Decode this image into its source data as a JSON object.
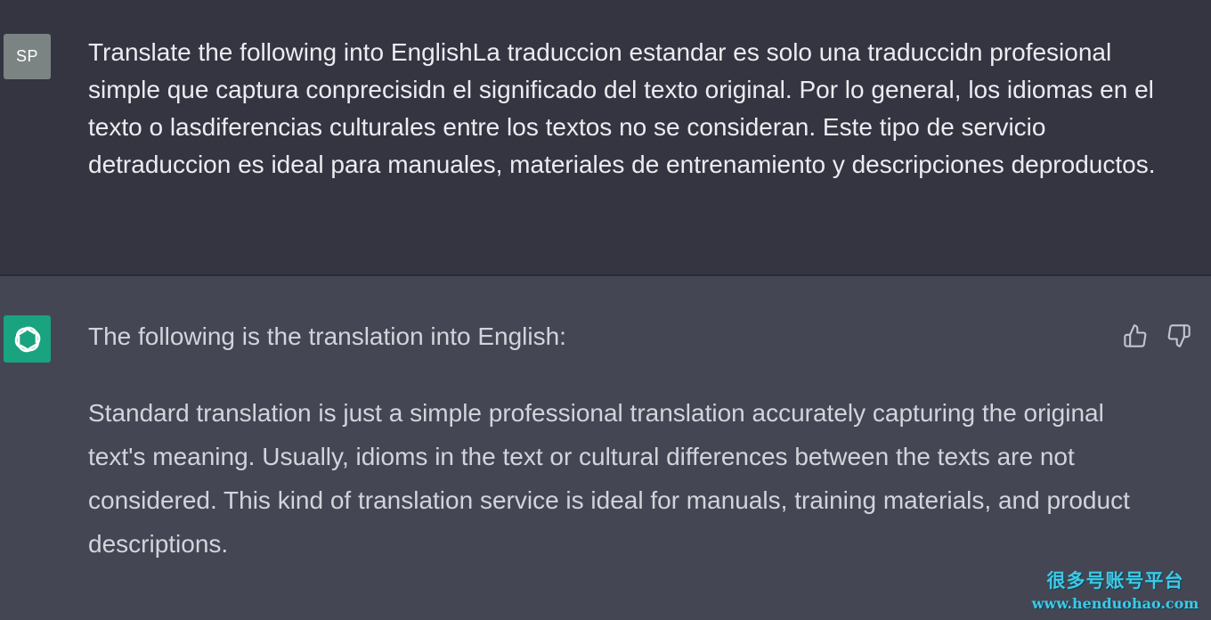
{
  "user_message": {
    "avatar_initials": "SP",
    "text": "Translate the following into EnglishLa traduccion estandar es solo una traduccidn profesional simple que captura conprecisidn el significado del texto original. Por lo general, los idiomas en el texto o lasdiferencias culturales entre los textos no se consideran. Este tipo de servicio detraduccion es ideal para manuales, materiales de entrenamiento y descripciones deproductos."
  },
  "assistant_message": {
    "avatar_icon": "openai-logo-icon",
    "intro": "The following is the translation into English:",
    "body": "Standard translation is just a simple professional translation accurately capturing the original text's meaning. Usually, idioms in the text or cultural differences between the texts are not considered. This kind of translation service is ideal for manuals, training materials, and product descriptions.",
    "feedback_icons": [
      "thumbs-up-icon",
      "thumbs-down-icon"
    ]
  },
  "watermark": {
    "chinese": "很多号账号平台",
    "url": "www.henduohao.com"
  },
  "colors": {
    "user_bg": "#343541",
    "assistant_bg": "#444654",
    "user_avatar": "#7c8383",
    "bot_avatar": "#19a37f",
    "watermark": "#3ec9e6"
  }
}
